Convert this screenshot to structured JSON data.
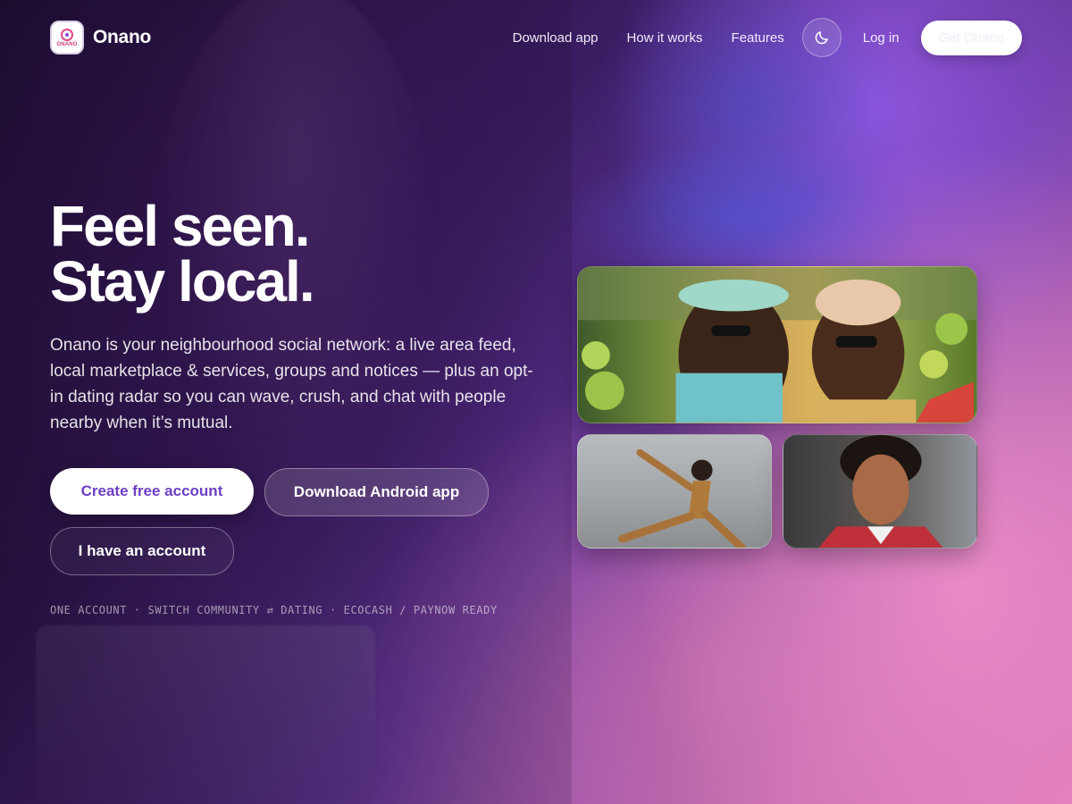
{
  "brand": {
    "name": "Onano",
    "badge_text": "ONANO"
  },
  "nav": {
    "download_app": "Download app",
    "how_it_works": "How it works",
    "features": "Features",
    "theme_toggle_icon": "moon-icon",
    "login": "Log in",
    "get_onano": "Get Onano"
  },
  "hero": {
    "title_line1": "Feel seen.",
    "title_line2": "Stay local.",
    "description": "Onano is your neighbourhood social network: a live area feed, local marketplace & services, groups and notices — plus an opt-in dating radar so you can wave, crush, and chat with people nearby when it’s mutual.",
    "cta_primary": "Create free account",
    "cta_android": "Download Android app",
    "cta_login": "I have an account",
    "tagline": "ONE ACCOUNT · SWITCH COMMUNITY ⇄ DATING · ECOCASH / PAYNOW READY"
  },
  "colors": {
    "accent": "#6c3fc6",
    "brand_pink": "#e0478a",
    "white": "#ffffff"
  }
}
